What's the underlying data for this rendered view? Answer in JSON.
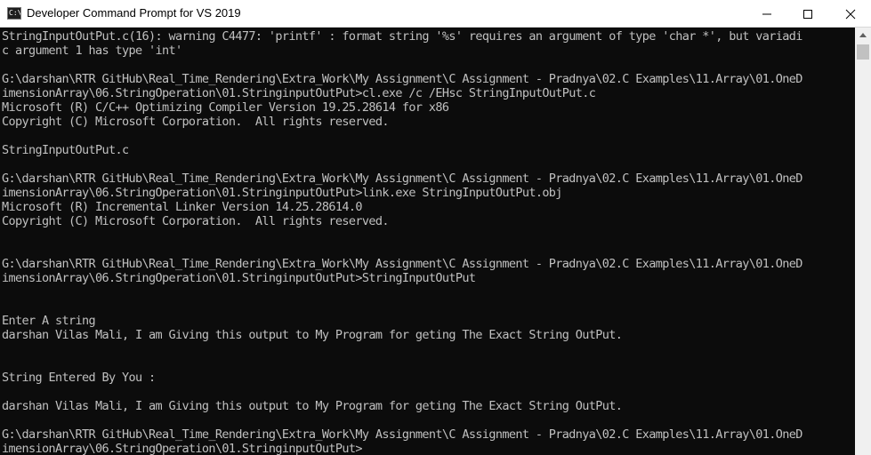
{
  "window": {
    "title": "Developer Command Prompt for VS 2019",
    "icon_text": "C:\\",
    "icon": "console-icon"
  },
  "controls": {
    "minimize_icon": "minimize-icon",
    "maximize_icon": "maximize-icon",
    "close_icon": "close-icon"
  },
  "console": {
    "lines": [
      "StringInputOutPut.c(16): warning C4477: 'printf' : format string '%s' requires an argument of type 'char *', but variadi",
      "c argument 1 has type 'int'",
      "",
      "G:\\darshan\\RTR GitHub\\Real_Time_Rendering\\Extra_Work\\My Assignment\\C Assignment - Pradnya\\02.C Examples\\11.Array\\01.OneD",
      "imensionArray\\06.StringOperation\\01.StringinputOutPut>cl.exe /c /EHsc StringInputOutPut.c",
      "Microsoft (R) C/C++ Optimizing Compiler Version 19.25.28614 for x86",
      "Copyright (C) Microsoft Corporation.  All rights reserved.",
      "",
      "StringInputOutPut.c",
      "",
      "G:\\darshan\\RTR GitHub\\Real_Time_Rendering\\Extra_Work\\My Assignment\\C Assignment - Pradnya\\02.C Examples\\11.Array\\01.OneD",
      "imensionArray\\06.StringOperation\\01.StringinputOutPut>link.exe StringInputOutPut.obj",
      "Microsoft (R) Incremental Linker Version 14.25.28614.0",
      "Copyright (C) Microsoft Corporation.  All rights reserved.",
      "",
      "",
      "G:\\darshan\\RTR GitHub\\Real_Time_Rendering\\Extra_Work\\My Assignment\\C Assignment - Pradnya\\02.C Examples\\11.Array\\01.OneD",
      "imensionArray\\06.StringOperation\\01.StringinputOutPut>StringInputOutPut",
      "",
      "",
      "Enter A string",
      "darshan Vilas Mali, I am Giving this output to My Program for geting The Exact String OutPut.",
      "",
      "",
      "String Entered By You :",
      "",
      "darshan Vilas Mali, I am Giving this output to My Program for geting The Exact String OutPut.",
      "",
      "G:\\darshan\\RTR GitHub\\Real_Time_Rendering\\Extra_Work\\My Assignment\\C Assignment - Pradnya\\02.C Examples\\11.Array\\01.OneD",
      "imensionArray\\06.StringOperation\\01.StringinputOutPut>"
    ]
  },
  "scrollbar": {
    "up_icon": "scroll-up-icon"
  },
  "colors": {
    "console_bg": "#0c0c0c",
    "console_text": "#c0c0c0",
    "titlebar_bg": "#ffffff"
  }
}
